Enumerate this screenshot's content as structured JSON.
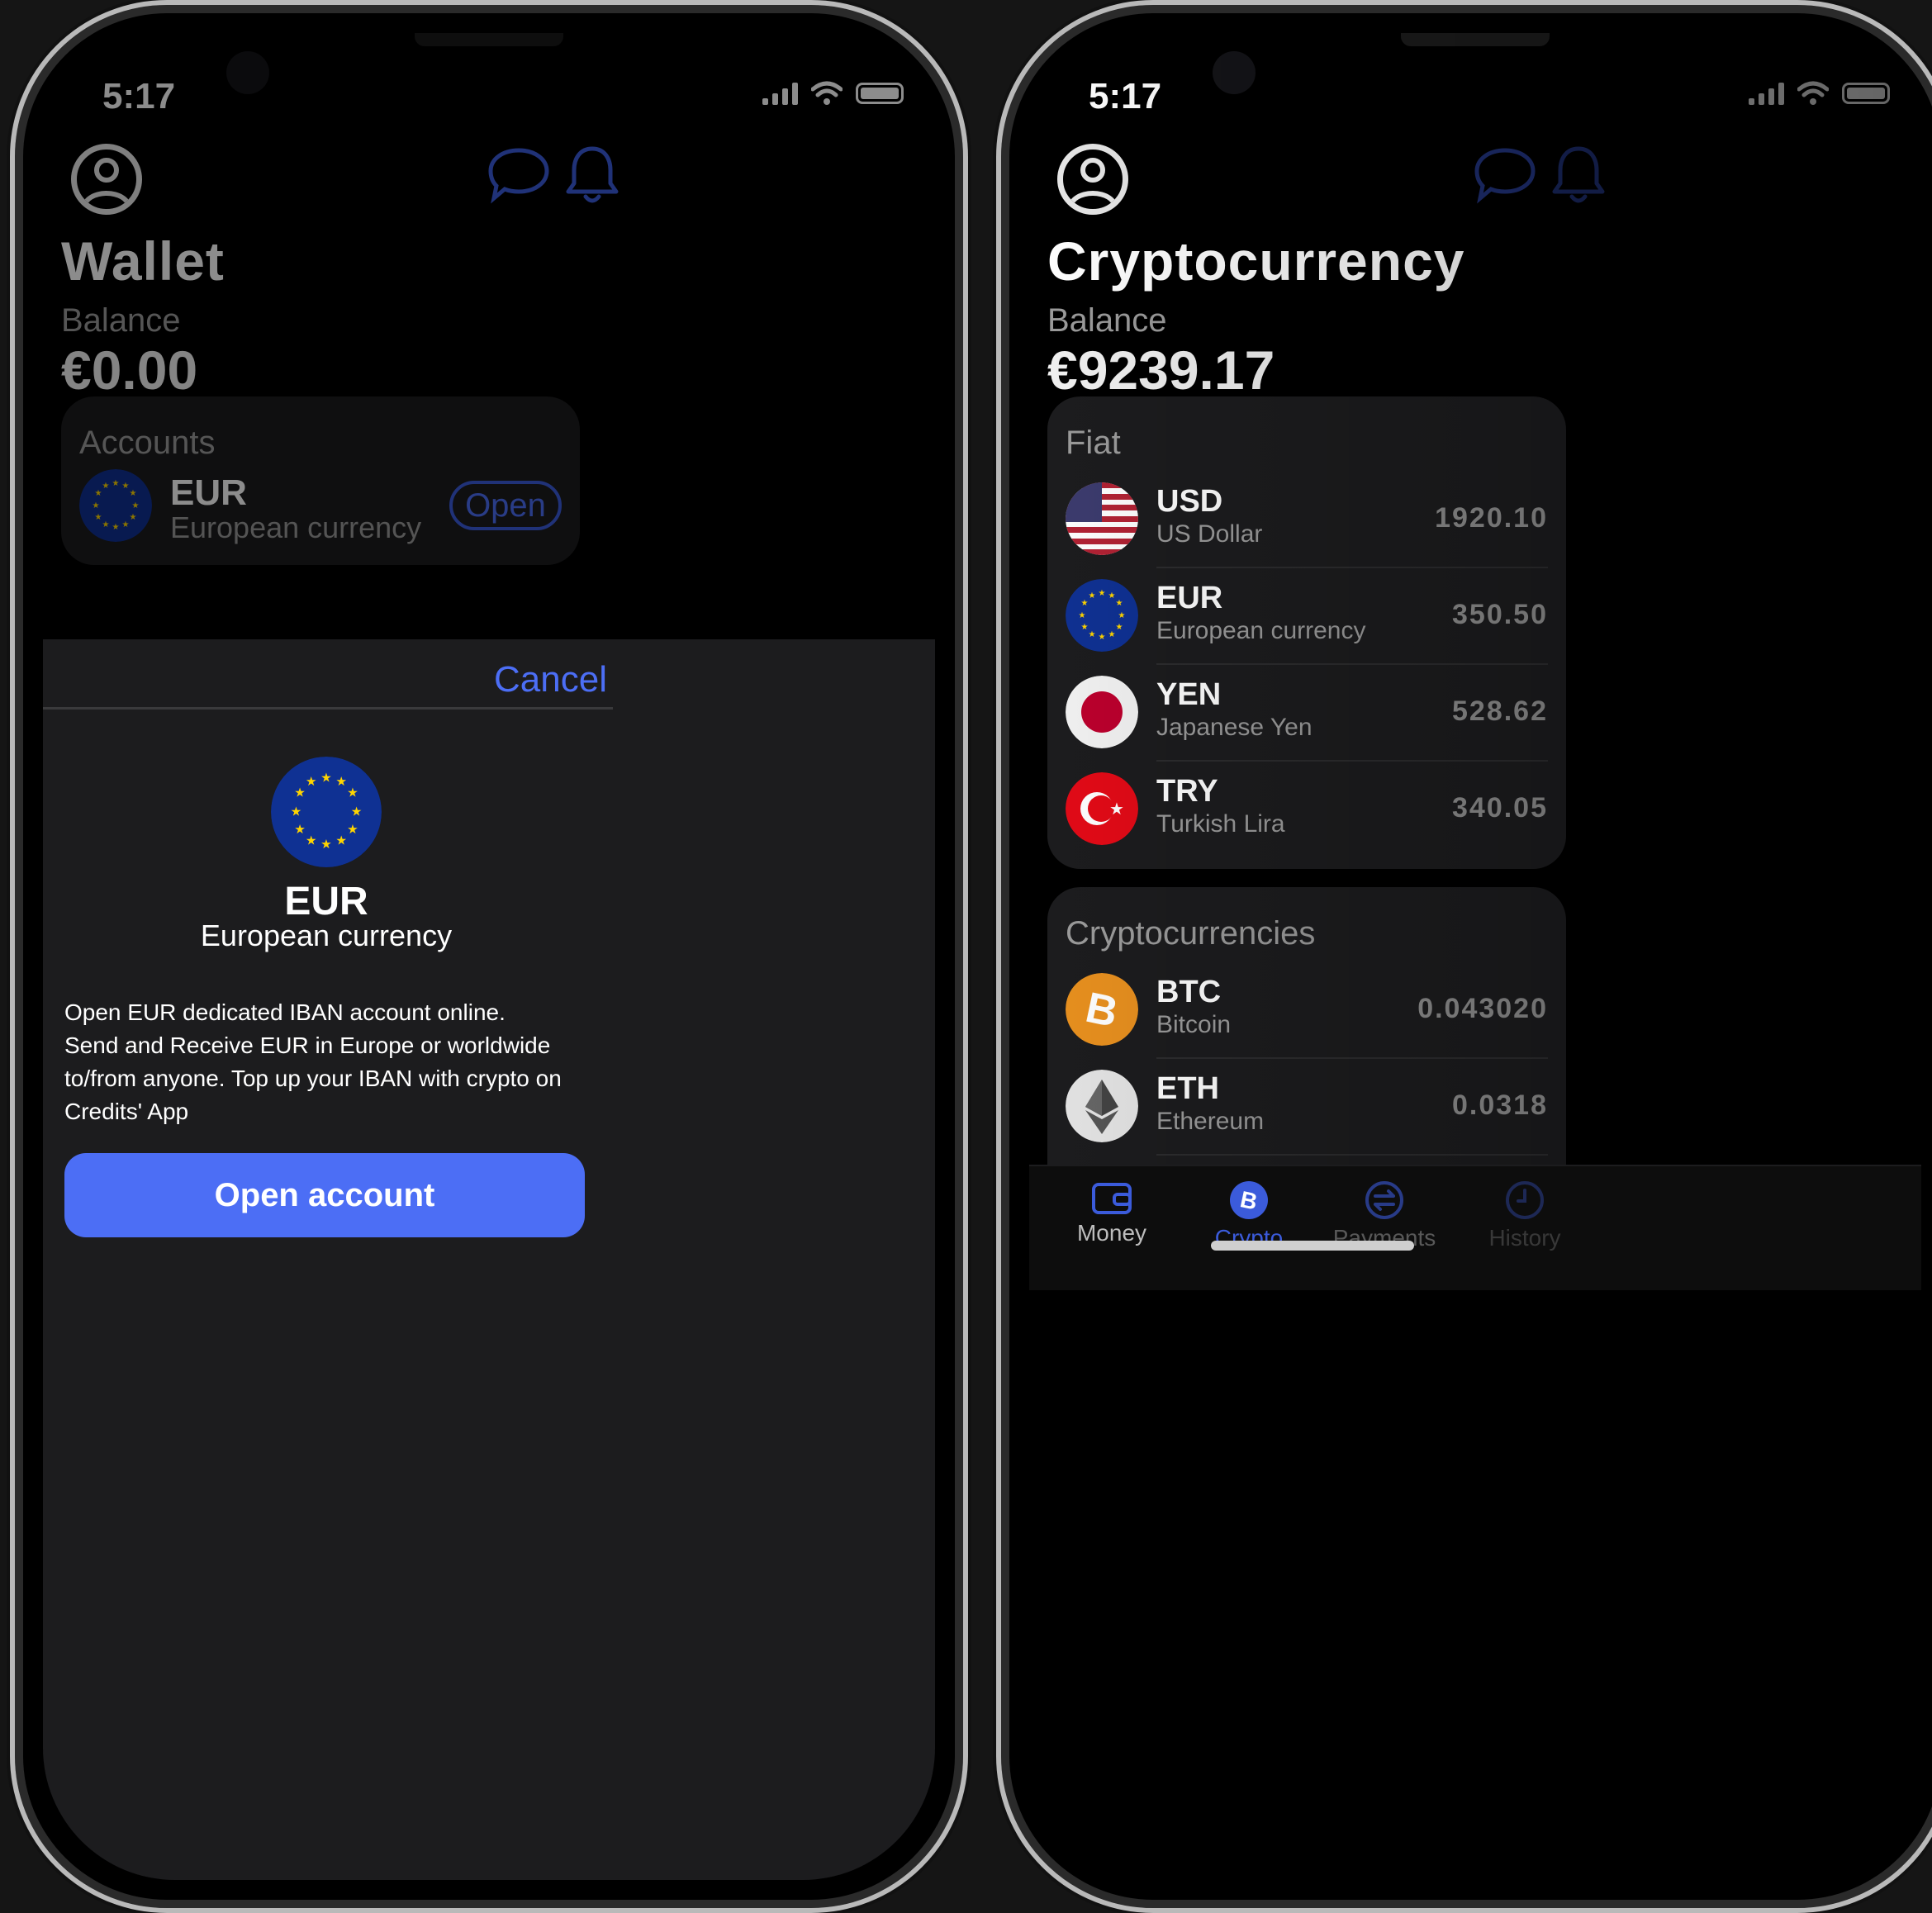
{
  "colors": {
    "accent": "#4c6ef5",
    "background": "#000000",
    "card": "#1c1c1e"
  },
  "left_phone": {
    "status_time": "5:17",
    "title": "Wallet",
    "balance_label": "Balance",
    "balance_amount": "€0.00",
    "accounts_card": {
      "title": "Accounts",
      "item": {
        "code": "EUR",
        "name": "European currency",
        "action": "Open",
        "flag_icon": "eu-flag-icon"
      }
    },
    "sheet": {
      "cancel_label": "Cancel",
      "currency_code": "EUR",
      "currency_name": "European currency",
      "description_lines": [
        "Open EUR dedicated IBAN account online.",
        "Send and Receive EUR in Europe or worldwide",
        "to/from anyone. Top up your IBAN with crypto on",
        "Credits' App"
      ],
      "button_label": "Open account"
    }
  },
  "right_phone": {
    "status_time": "5:17",
    "title": "Cryptocurrency",
    "balance_label": "Balance",
    "balance_amount": "€9239.17",
    "fiat_card": {
      "title": "Fiat",
      "items": [
        {
          "code": "USD",
          "name": "US Dollar",
          "value": "1920.10",
          "icon": "us-flag-icon"
        },
        {
          "code": "EUR",
          "name": "European currency",
          "value": "350.50",
          "icon": "eu-flag-icon"
        },
        {
          "code": "YEN",
          "name": "Japanese Yen",
          "value": "528.62",
          "icon": "japan-flag-icon"
        },
        {
          "code": "TRY",
          "name": "Turkish Lira",
          "value": "340.05",
          "icon": "turkey-flag-icon"
        }
      ]
    },
    "crypto_card": {
      "title": "Cryptocurrencies",
      "items": [
        {
          "code": "BTC",
          "name": "Bitcoin",
          "value": "0.043020",
          "icon": "bitcoin-icon"
        },
        {
          "code": "ETH",
          "name": "Ethereum",
          "value": "0.0318",
          "icon": "ethereum-icon"
        }
      ]
    },
    "tabs": [
      {
        "label": "Money",
        "icon": "wallet-icon",
        "active": false
      },
      {
        "label": "Crypto",
        "icon": "bitcoin-tab-icon",
        "active": true
      },
      {
        "label": "Payments",
        "icon": "payments-icon",
        "active": false
      },
      {
        "label": "History",
        "icon": "clock-icon",
        "active": false
      }
    ]
  }
}
